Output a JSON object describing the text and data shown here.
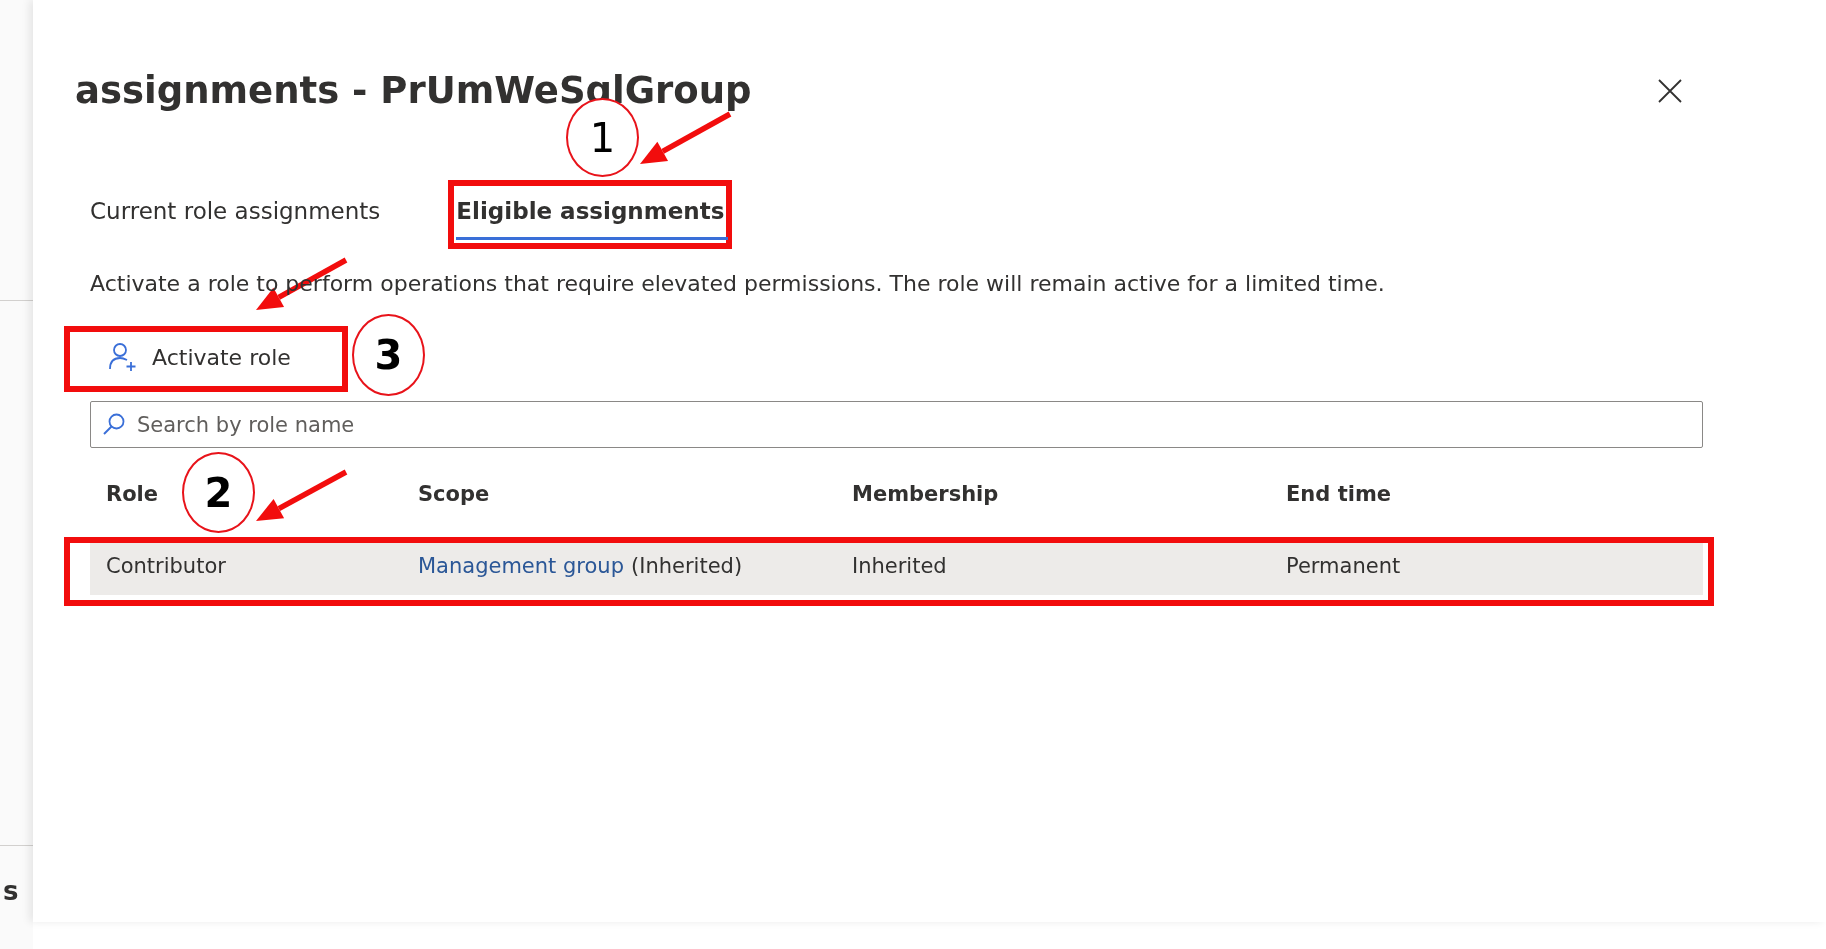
{
  "background_page": {
    "partial_text": "s"
  },
  "panel": {
    "title": "assignments - PrUmWeSqlGroup",
    "tabs": [
      {
        "label": "Current role assignments",
        "selected": false
      },
      {
        "label": "Eligible assignments",
        "selected": true
      }
    ],
    "description": "Activate a role to perform operations that require elevated permissions. The role will remain active for a limited time.",
    "toolbar": {
      "label": "Activate role"
    },
    "search": {
      "placeholder": "Search by role name"
    },
    "table": {
      "columns": [
        "Role",
        "Scope",
        "Membership",
        "End time"
      ],
      "rows": [
        {
          "selected": true,
          "cells": [
            {
              "text": "Contributor"
            },
            {
              "link": "Management group",
              "text": "(Inherited)"
            },
            {
              "text": "Inherited"
            },
            {
              "text": "Permanent"
            }
          ]
        }
      ]
    }
  },
  "annotations": [
    {
      "kind": "highlight"
    },
    {
      "kind": "highlight"
    },
    {
      "kind": "highlight"
    },
    {
      "kind": "arrow"
    },
    {
      "kind": "arrow"
    },
    {
      "kind": "arrow"
    },
    {
      "kind": "callout",
      "label": "1",
      "bold": false
    },
    {
      "kind": "callout",
      "label": "2",
      "bold": true
    },
    {
      "kind": "callout",
      "label": "3",
      "bold": true
    }
  ]
}
